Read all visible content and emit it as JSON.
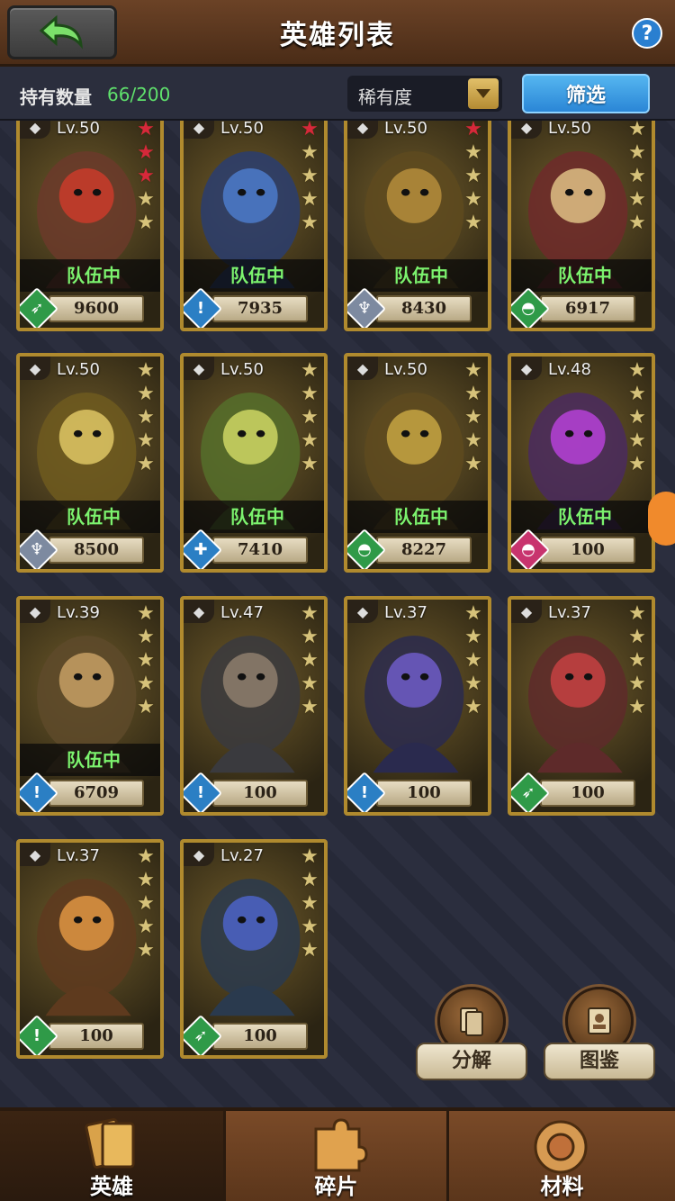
{
  "header": {
    "title": "英雄列表",
    "help": "?"
  },
  "filter": {
    "own_label": "持有数量",
    "own_count": "66/200",
    "sort_value": "稀有度",
    "filter_label": "筛选"
  },
  "heroes": [
    {
      "lv": "Lv.50",
      "power": "9600",
      "team": "队伍中",
      "role": "archer",
      "stars_red": 3,
      "stars_total": 5
    },
    {
      "lv": "Lv.50",
      "power": "7935",
      "team": "队伍中",
      "role": "rogue",
      "stars_red": 1,
      "stars_total": 5
    },
    {
      "lv": "Lv.50",
      "power": "8430",
      "team": "队伍中",
      "role": "mage",
      "stars_red": 1,
      "stars_total": 5
    },
    {
      "lv": "Lv.50",
      "power": "6917",
      "team": "队伍中",
      "role": "tank",
      "stars_red": 0,
      "stars_total": 5
    },
    {
      "lv": "Lv.50",
      "power": "8500",
      "team": "队伍中",
      "role": "mage",
      "stars_red": 0,
      "stars_total": 5
    },
    {
      "lv": "Lv.50",
      "power": "7410",
      "team": "队伍中",
      "role": "healer",
      "stars_red": 0,
      "stars_total": 5
    },
    {
      "lv": "Lv.50",
      "power": "8227",
      "team": "队伍中",
      "role": "tank",
      "stars_red": 0,
      "stars_total": 5
    },
    {
      "lv": "Lv.48",
      "power": "100",
      "team": "队伍中",
      "role": "tank-pink",
      "stars_red": 0,
      "stars_total": 5
    },
    {
      "lv": "Lv.39",
      "power": "6709",
      "team": "队伍中",
      "role": "rogue",
      "stars_red": 0,
      "stars_total": 5
    },
    {
      "lv": "Lv.47",
      "power": "100",
      "team": "",
      "role": "rogue",
      "stars_red": 0,
      "stars_total": 5
    },
    {
      "lv": "Lv.37",
      "power": "100",
      "team": "",
      "role": "rogue",
      "stars_red": 0,
      "stars_total": 5
    },
    {
      "lv": "Lv.37",
      "power": "100",
      "team": "",
      "role": "archer",
      "stars_red": 0,
      "stars_total": 5
    },
    {
      "lv": "Lv.37",
      "power": "100",
      "team": "",
      "role": "rogue-green",
      "stars_red": 0,
      "stars_total": 5
    },
    {
      "lv": "Lv.27",
      "power": "100",
      "team": "",
      "role": "archer",
      "stars_red": 0,
      "stars_total": 5
    }
  ],
  "actions": {
    "decompose": "分解",
    "codex": "图鉴"
  },
  "tabs": {
    "heroes": "英雄",
    "fragments": "碎片",
    "materials": "材料"
  },
  "icons": {
    "back": "back-arrow-icon",
    "help": "help-icon",
    "dropdown": "dropdown-arrow-icon",
    "archer": "archer-icon",
    "rogue": "dagger-icon",
    "mage": "staff-icon",
    "tank": "shield-icon",
    "healer": "cross-icon"
  }
}
